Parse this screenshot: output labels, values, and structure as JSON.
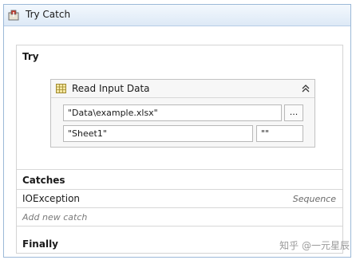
{
  "window": {
    "title": "Try Catch"
  },
  "try_section": {
    "label": "Try",
    "activity": {
      "title": "Read Input Data",
      "workbook_path": "\"Data\\example.xlsx\"",
      "browse_label": "...",
      "sheet_name": "\"Sheet1\"",
      "range": "\"\""
    }
  },
  "catches_section": {
    "label": "Catches",
    "items": [
      {
        "exception": "IOException",
        "handler": "Sequence"
      }
    ],
    "add_label": "Add new catch"
  },
  "finally_section": {
    "label": "Finally"
  },
  "watermark": "知乎 @一元星辰",
  "icons": {
    "title": "activity-icon",
    "activity": "excel-read-icon",
    "collapse": "chevron-double-up-icon"
  }
}
